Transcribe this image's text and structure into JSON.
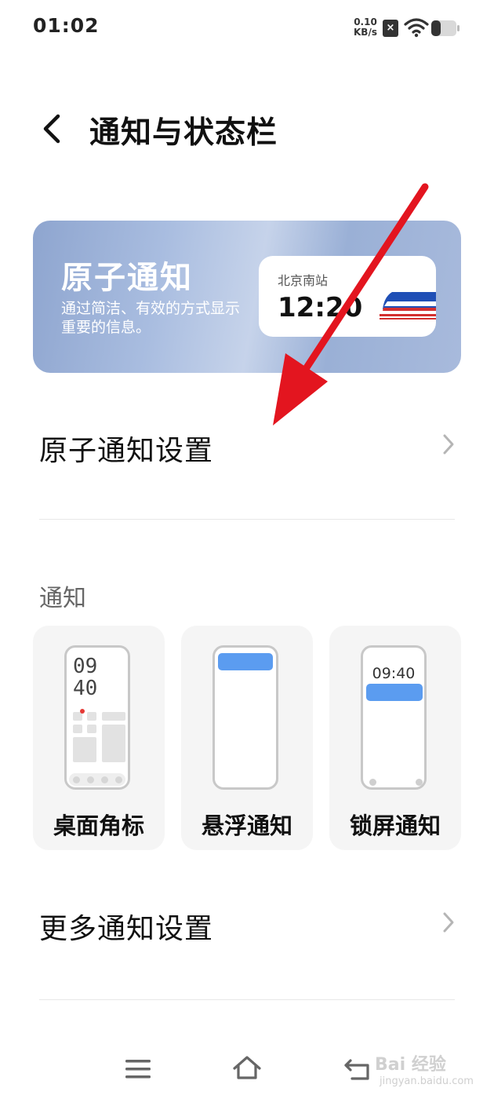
{
  "status_bar": {
    "time": "01:02",
    "net_speed_value": "0.10",
    "net_speed_unit": "KB/s",
    "sim_icon": "sim-disabled-icon",
    "wifi_icon": "wifi-icon",
    "battery_icon": "battery-icon"
  },
  "header": {
    "back_icon": "chevron-left-icon",
    "title": "通知与状态栏"
  },
  "banner": {
    "title": "原子通知",
    "description": "通过简洁、有效的方式显示重要的信息。",
    "card": {
      "station": "北京南站",
      "time": "12:20",
      "icon": "train-icon"
    }
  },
  "atomic_settings": {
    "label": "原子通知设置",
    "chevron": "chevron-right-icon"
  },
  "notifications_section": {
    "label": "通知",
    "cards": [
      {
        "label": "桌面角标",
        "preview_time_line1": "09",
        "preview_time_line2": "40"
      },
      {
        "label": "悬浮通知"
      },
      {
        "label": "锁屏通知",
        "preview_time": "09:40"
      }
    ]
  },
  "more_settings": {
    "label": "更多通知设置",
    "chevron": "chevron-right-icon"
  },
  "nav_bar": {
    "menu_icon": "menu-icon",
    "home_icon": "home-icon",
    "back_icon": "back-icon"
  },
  "colors": {
    "accent_arrow": "#e3151f",
    "notification_blue": "#5b9cf0"
  },
  "watermark": {
    "text": "Bai 经验",
    "sub": "jingyan.baidu.com"
  }
}
